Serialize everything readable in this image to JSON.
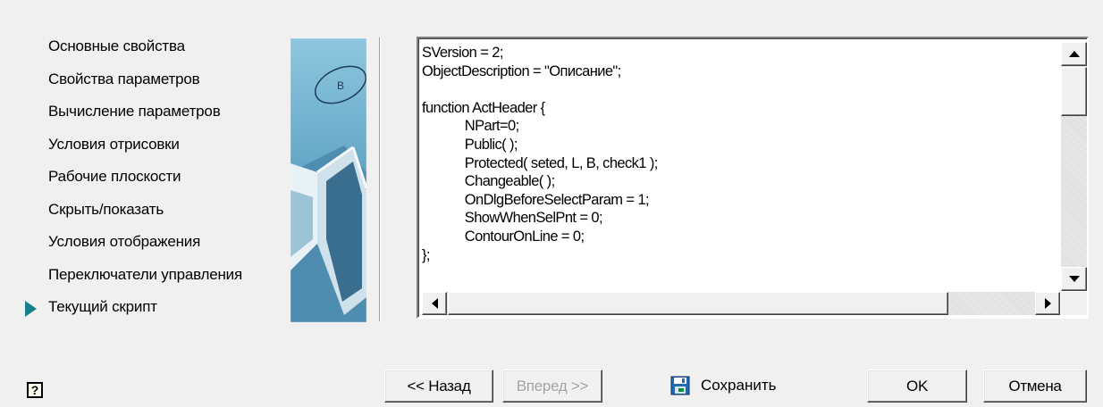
{
  "wizard": {
    "steps": [
      {
        "label": "Основные свойства",
        "current": false
      },
      {
        "label": "Свойства параметров",
        "current": false
      },
      {
        "label": "Вычисление параметров",
        "current": false
      },
      {
        "label": "Условия отрисовки",
        "current": false
      },
      {
        "label": "Рабочие плоскости",
        "current": false
      },
      {
        "label": "Скрыть/показать",
        "current": false
      },
      {
        "label": "Условия отображения",
        "current": false
      },
      {
        "label": "Переключатели управления",
        "current": false
      },
      {
        "label": "Текущий скрипт",
        "current": true
      }
    ],
    "accent_color": "#15818c"
  },
  "script_editor": {
    "code": "SVersion = 2;\nObjectDescription = \"Описание\";\n\nfunction ActHeader {\n            NPart=0;\n            Public( );\n            Protected( seted, L, B, check1 );\n            Changeable( );\n            OnDlgBeforeSelectParam = 1;\n            ShowWhenSelPnt = 0;\n            ContourOnLine = 0;\n};"
  },
  "footer": {
    "help_glyph": "?",
    "back_label": "<< Назад",
    "next_label": "Вперед >>",
    "save_label": "Сохранить",
    "ok_label": "OK",
    "cancel_label": "Отмена"
  },
  "icons": {
    "help": "help-icon",
    "save": "save-disk-icon",
    "step_marker": "current-step-arrow-icon"
  }
}
